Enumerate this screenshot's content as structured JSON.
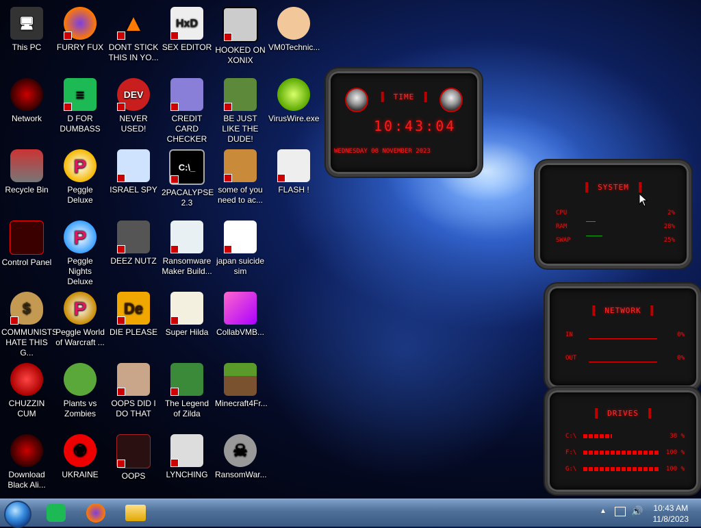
{
  "desktop": {
    "icons": [
      {
        "label": "This PC"
      },
      {
        "label": "FURRY FUX"
      },
      {
        "label": "DONT STICK THIS IN YO..."
      },
      {
        "label": "SEX EDITOR"
      },
      {
        "label": "HOOKED ON XONIX"
      },
      {
        "label": "VM0Technic..."
      },
      {
        "label": "Network"
      },
      {
        "label": "D FOR DUMBASS"
      },
      {
        "label": "NEVER USED!"
      },
      {
        "label": "CREDIT CARD CHECKER"
      },
      {
        "label": "BE JUST LIKE THE DUDE!"
      },
      {
        "label": "VirusWire.exe"
      },
      {
        "label": "Recycle Bin"
      },
      {
        "label": "Peggle Deluxe"
      },
      {
        "label": "ISRAEL SPY"
      },
      {
        "label": "2PACALYPSE 2.3"
      },
      {
        "label": "some of you need to ac..."
      },
      {
        "label": "FLASH !"
      },
      {
        "label": "Control Panel"
      },
      {
        "label": "Peggle Nights Deluxe"
      },
      {
        "label": "DEEZ NUTZ"
      },
      {
        "label": "Ransomware Maker Build..."
      },
      {
        "label": "japan suicide sim"
      },
      {
        "label": "COMMUNISTS HATE THIS G..."
      },
      {
        "label": "Peggle World of Warcraft ..."
      },
      {
        "label": "DIE PLEASE"
      },
      {
        "label": "Super Hilda"
      },
      {
        "label": "CollabVMB..."
      },
      {
        "label": "CHUZZIN CUM"
      },
      {
        "label": "Plants vs Zombies"
      },
      {
        "label": "OOPS DID I DO THAT"
      },
      {
        "label": "The Legend of Zilda"
      },
      {
        "label": "Minecraft4Fr..."
      },
      {
        "label": "Download Black Ali..."
      },
      {
        "label": "UKRAINE"
      },
      {
        "label": "OOPS"
      },
      {
        "label": "LYNCHING"
      },
      {
        "label": "RansomWar..."
      }
    ]
  },
  "widgets": {
    "time": {
      "title": "TIME",
      "clock": "10:43:04",
      "date": "WEDNESDAY 08 NOVEMBER 2023"
    },
    "system": {
      "title": "SYSTEM",
      "rows": [
        {
          "label": "CPU",
          "value": "2%"
        },
        {
          "label": "RAM",
          "value": "28%"
        },
        {
          "label": "SWAP",
          "value": "25%"
        }
      ]
    },
    "network": {
      "title": "NETWORK",
      "rows": [
        {
          "label": "IN",
          "value": "0%"
        },
        {
          "label": "OUT",
          "value": "0%"
        }
      ]
    },
    "drives": {
      "title": "DRIVES",
      "rows": [
        {
          "label": "C:\\",
          "value": "38 %",
          "fill": 0.38
        },
        {
          "label": "F:\\",
          "value": "100 %",
          "fill": 1.0
        },
        {
          "label": "G:\\",
          "value": "100 %",
          "fill": 1.0
        }
      ]
    }
  },
  "taskbar": {
    "apps": [
      {
        "name": "Spotify"
      },
      {
        "name": "Firefox"
      },
      {
        "name": "File Explorer"
      }
    ],
    "clock_time": "10:43 AM",
    "clock_date": "11/8/2023"
  },
  "colors": {
    "widget_red": "#ff1a1a",
    "taskbar": "#4e6f98"
  }
}
